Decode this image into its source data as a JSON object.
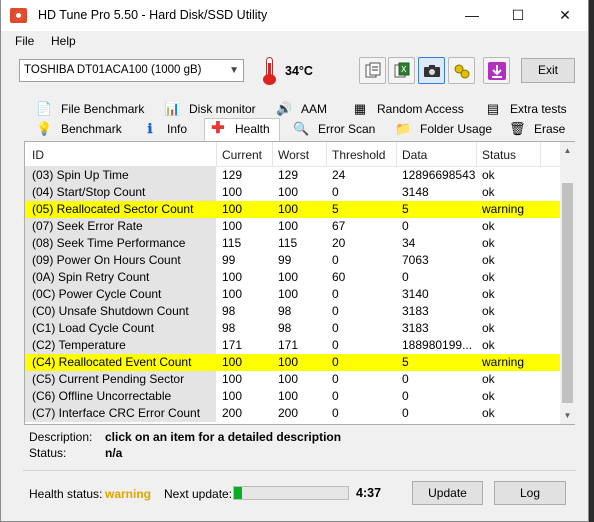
{
  "window": {
    "title": "HD Tune Pro 5.50 - Hard Disk/SSD Utility",
    "controls": {
      "minimize": "—",
      "maximize": "☐",
      "close": "✕"
    }
  },
  "menu": {
    "file": "File",
    "help": "Help"
  },
  "toolbar": {
    "drive": "TOSHIBA DT01ACA100 (1000 gB)",
    "temperature": "34°C",
    "exit_label": "Exit",
    "icons": [
      "copy-text-icon",
      "copy-excel-icon",
      "screenshot-icon",
      "options-icon",
      "save-download-icon"
    ]
  },
  "tabs": {
    "row1": [
      "File Benchmark",
      "Disk monitor",
      "AAM",
      "Random Access",
      "Extra tests"
    ],
    "row2": [
      "Benchmark",
      "Info",
      "Health",
      "Error Scan",
      "Folder Usage",
      "Erase"
    ],
    "active": "Health"
  },
  "grid": {
    "columns": [
      "ID",
      "Current",
      "Worst",
      "Threshold",
      "Data",
      "Status"
    ],
    "rows": [
      {
        "id": "(03) Spin Up Time",
        "current": "129",
        "worst": "129",
        "threshold": "24",
        "data": "12896698543",
        "status": "ok",
        "warning": false
      },
      {
        "id": "(04) Start/Stop Count",
        "current": "100",
        "worst": "100",
        "threshold": "0",
        "data": "3148",
        "status": "ok",
        "warning": false
      },
      {
        "id": "(05) Reallocated Sector Count",
        "current": "100",
        "worst": "100",
        "threshold": "5",
        "data": "5",
        "status": "warning",
        "warning": true
      },
      {
        "id": "(07) Seek Error Rate",
        "current": "100",
        "worst": "100",
        "threshold": "67",
        "data": "0",
        "status": "ok",
        "warning": false
      },
      {
        "id": "(08) Seek Time Performance",
        "current": "115",
        "worst": "115",
        "threshold": "20",
        "data": "34",
        "status": "ok",
        "warning": false
      },
      {
        "id": "(09) Power On Hours Count",
        "current": "99",
        "worst": "99",
        "threshold": "0",
        "data": "7063",
        "status": "ok",
        "warning": false
      },
      {
        "id": "(0A) Spin Retry Count",
        "current": "100",
        "worst": "100",
        "threshold": "60",
        "data": "0",
        "status": "ok",
        "warning": false
      },
      {
        "id": "(0C) Power Cycle Count",
        "current": "100",
        "worst": "100",
        "threshold": "0",
        "data": "3140",
        "status": "ok",
        "warning": false
      },
      {
        "id": "(C0) Unsafe Shutdown Count",
        "current": "98",
        "worst": "98",
        "threshold": "0",
        "data": "3183",
        "status": "ok",
        "warning": false
      },
      {
        "id": "(C1) Load Cycle Count",
        "current": "98",
        "worst": "98",
        "threshold": "0",
        "data": "3183",
        "status": "ok",
        "warning": false
      },
      {
        "id": "(C2) Temperature",
        "current": "171",
        "worst": "171",
        "threshold": "0",
        "data": "188980199...",
        "status": "ok",
        "warning": false
      },
      {
        "id": "(C4) Reallocated Event Count",
        "current": "100",
        "worst": "100",
        "threshold": "0",
        "data": "5",
        "status": "warning",
        "warning": true
      },
      {
        "id": "(C5) Current Pending Sector",
        "current": "100",
        "worst": "100",
        "threshold": "0",
        "data": "0",
        "status": "ok",
        "warning": false
      },
      {
        "id": "(C6) Offline Uncorrectable",
        "current": "100",
        "worst": "100",
        "threshold": "0",
        "data": "0",
        "status": "ok",
        "warning": false
      },
      {
        "id": "(C7) Interface CRC Error Count",
        "current": "200",
        "worst": "200",
        "threshold": "0",
        "data": "0",
        "status": "ok",
        "warning": false
      }
    ]
  },
  "description": {
    "label": "Description:",
    "value": "click on an item for a detailed description",
    "status_label": "Status:",
    "status_value": "n/a"
  },
  "footer": {
    "health_label": "Health status:",
    "health_value": "warning",
    "next_update_label": "Next update:",
    "next_update_value": "4:37",
    "progress_fraction": 0.07,
    "update_label": "Update",
    "log_label": "Log"
  },
  "colors": {
    "warning_row": "#ffff00",
    "health_warning_text": "#e3a400",
    "progress": "#06b025"
  }
}
